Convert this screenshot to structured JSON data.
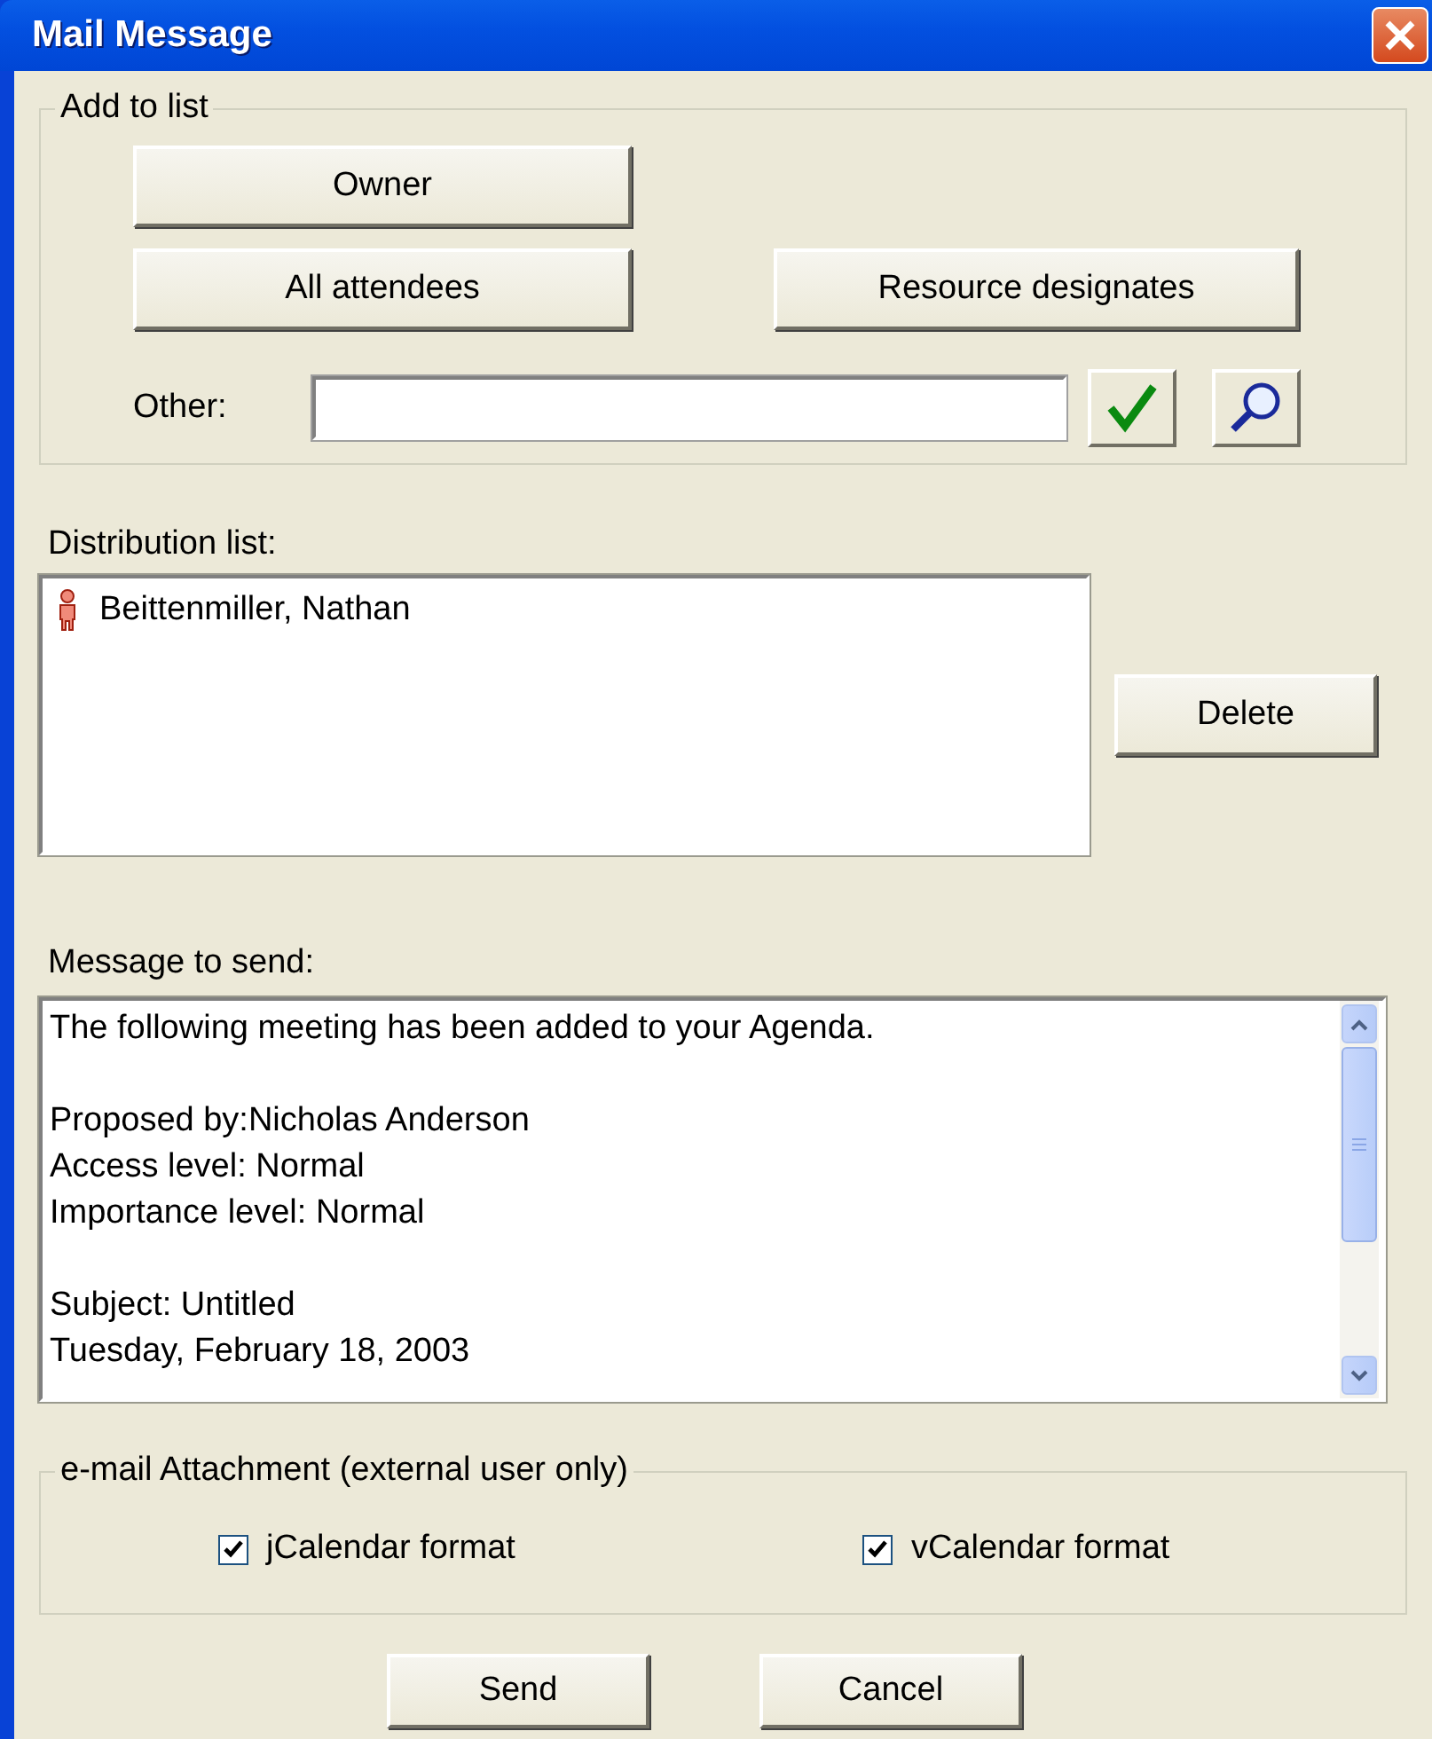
{
  "window": {
    "title": "Mail Message"
  },
  "add_to_list": {
    "label": "Add to list",
    "buttons": [
      {
        "label": "Owner"
      },
      {
        "label": "All attendees"
      },
      {
        "label": "Resource designates"
      }
    ],
    "other": {
      "label": "Other:"
    }
  },
  "distribution_list": {
    "label": "Distribution list:",
    "items": [
      {
        "name": "Beittenmiller, Nathan"
      }
    ],
    "delete_button": "Delete"
  },
  "message": {
    "label": "Message to send:",
    "paragraphs": [
      [
        "The following meeting has been added to your Agenda."
      ],
      [
        "Proposed by:Nicholas Anderson",
        "Access level: Normal",
        "Importance level: Normal"
      ],
      [
        "Subject: Untitled",
        "Tuesday, February 18, 2003"
      ]
    ]
  },
  "attachment": {
    "label": "e-mail Attachment (external user only)",
    "options": [
      {
        "label": "jCalendar format",
        "checked": true
      },
      {
        "label": "vCalendar format",
        "checked": true
      }
    ]
  },
  "buttons": [
    "Send",
    "Cancel"
  ]
}
